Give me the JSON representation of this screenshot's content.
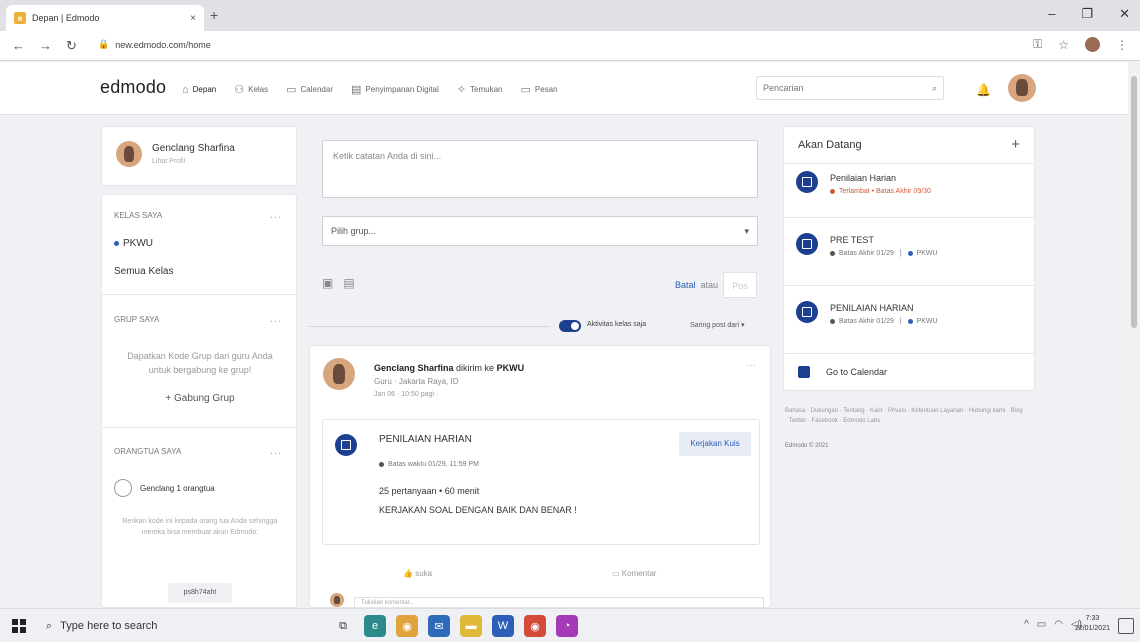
{
  "browser": {
    "tab_title": "Depan | Edmodo",
    "tab_close": "×",
    "new_tab": "+",
    "url": "new.edmodo.com/home",
    "win_min": "–",
    "win_max": "❐",
    "win_close": "✕"
  },
  "nav": {
    "logo": "edmodo",
    "items": [
      "Depan",
      "Kelas",
      "Calendar",
      "Penyimpanan Digital",
      "Temukan",
      "Pesan"
    ],
    "search_placeholder": "Pencarian"
  },
  "profile": {
    "name": "Genclang Sharfina",
    "link": "Lihat Profil"
  },
  "left": {
    "classes_heading": "KELAS SAYA",
    "classes": [
      "PKWU"
    ],
    "all_classes": "Semua Kelas",
    "groups_heading": "GRUP SAYA",
    "groups_hint": "Dapatkan Kode Grup dari guru Anda untuk bergabung ke grup!",
    "join_group": "+ Gabung Grup",
    "parents_heading": "ORANGTUA SAYA",
    "parents_item": "Genclang 1 orangtua",
    "parents_hint": "Berikan kode ini kepada orang tua Anda sehingga mereka bisa membuat akun Edmodo:",
    "parent_code": "ps8h74aht",
    "more": "..."
  },
  "composer": {
    "note_placeholder": "Ketik catatan Anda di sini...",
    "group_select": "Pilih grup...",
    "cancel": "Batal",
    "or": "atau",
    "post": "Pos"
  },
  "filter": {
    "class_only": "Aktivitas kelas saja",
    "filter_by": "Saring post dari ▾"
  },
  "post": {
    "author": "Genclang Sharfina",
    "sent_to": "dikirim ke",
    "class": "PKWU",
    "subtitle": "Guru · Jakarta Raya, ID",
    "meta": "Jan 06 · 10:50 pagi ·",
    "more": "···",
    "quiz_title": "PENILAIAN HARIAN",
    "quiz_button": "Kerjakan Kuis",
    "quiz_due": "Batas waktu 01/29, 11:59 PM",
    "quiz_count": "25 pertanyaan • 60 menit",
    "quiz_instructions": "KERJAKAN SOAL DENGAN BAIK DAN BENAR !",
    "like": "suka",
    "comment": "Komentar",
    "comment_placeholder": "Tuliskan komentar..."
  },
  "upcoming": {
    "heading": "Akan Datang",
    "add": "+",
    "items": [
      {
        "title": "Penilaian Harian",
        "sub": "Terlambat • Batas Akhir 09/30",
        "late": true
      },
      {
        "title": "PRE TEST",
        "sub": "Batas Akhir 01/29",
        "class": "PKWU",
        "late": false
      },
      {
        "title": "PENILAIAN HARIAN",
        "sub": "Batas Akhir 01/29",
        "class": "PKWU",
        "late": false
      }
    ],
    "calendar_link": "Go to Calendar"
  },
  "footer": {
    "links": "Bahasa · Dukungan · Tentang · Karir · Privasi · Ketentuan Layanan · Hubungi kami · Blog · Twitter · Facebook · Edmodo Labs",
    "copyright": "Edmodo © 2021"
  },
  "taskbar": {
    "search_placeholder": "Type here to search",
    "time": "7:33",
    "date": "22/01/2021"
  },
  "colors": {
    "accent": "#1d3f8f",
    "link": "#2e5fb8",
    "late": "#d25b3b"
  }
}
